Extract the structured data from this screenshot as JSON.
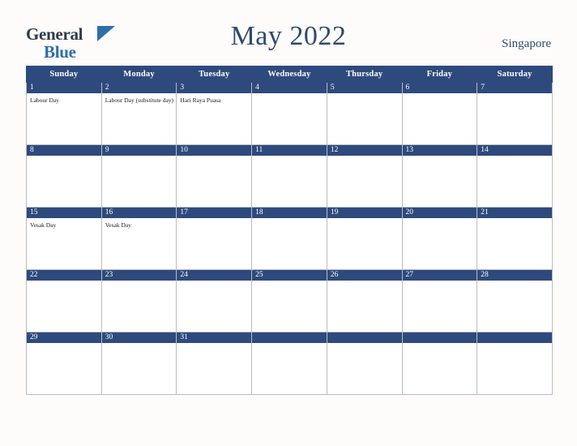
{
  "brand": {
    "word_general": "General",
    "word_blue": "Blue",
    "triangle_icon": "triangle-icon"
  },
  "header": {
    "title": "May 2022",
    "country": "Singapore"
  },
  "calendar": {
    "weekday_headers": [
      "Sunday",
      "Monday",
      "Tuesday",
      "Wednesday",
      "Thursday",
      "Friday",
      "Saturday"
    ],
    "colors": {
      "header_bg": "#2e4a7d",
      "daynum_bg": "#2e4a7d",
      "title_color": "#2e4a6e",
      "grid_border": "#b8bdc4",
      "page_bg": "#fdfcfa"
    },
    "weeks": [
      [
        {
          "day": "1",
          "events": [
            "Labour Day"
          ]
        },
        {
          "day": "2",
          "events": [
            "Labour Day (substitute day)"
          ]
        },
        {
          "day": "3",
          "events": [
            "Hari Raya Puasa"
          ]
        },
        {
          "day": "4",
          "events": []
        },
        {
          "day": "5",
          "events": []
        },
        {
          "day": "6",
          "events": []
        },
        {
          "day": "7",
          "events": []
        }
      ],
      [
        {
          "day": "8",
          "events": []
        },
        {
          "day": "9",
          "events": []
        },
        {
          "day": "10",
          "events": []
        },
        {
          "day": "11",
          "events": []
        },
        {
          "day": "12",
          "events": []
        },
        {
          "day": "13",
          "events": []
        },
        {
          "day": "14",
          "events": []
        }
      ],
      [
        {
          "day": "15",
          "events": [
            "Vesak Day"
          ]
        },
        {
          "day": "16",
          "events": [
            "Vesak Day"
          ]
        },
        {
          "day": "17",
          "events": []
        },
        {
          "day": "18",
          "events": []
        },
        {
          "day": "19",
          "events": []
        },
        {
          "day": "20",
          "events": []
        },
        {
          "day": "21",
          "events": []
        }
      ],
      [
        {
          "day": "22",
          "events": []
        },
        {
          "day": "23",
          "events": []
        },
        {
          "day": "24",
          "events": []
        },
        {
          "day": "25",
          "events": []
        },
        {
          "day": "26",
          "events": []
        },
        {
          "day": "27",
          "events": []
        },
        {
          "day": "28",
          "events": []
        }
      ],
      [
        {
          "day": "29",
          "events": []
        },
        {
          "day": "30",
          "events": []
        },
        {
          "day": "31",
          "events": []
        },
        {
          "day": "",
          "events": []
        },
        {
          "day": "",
          "events": []
        },
        {
          "day": "",
          "events": []
        },
        {
          "day": "",
          "events": []
        }
      ]
    ]
  }
}
